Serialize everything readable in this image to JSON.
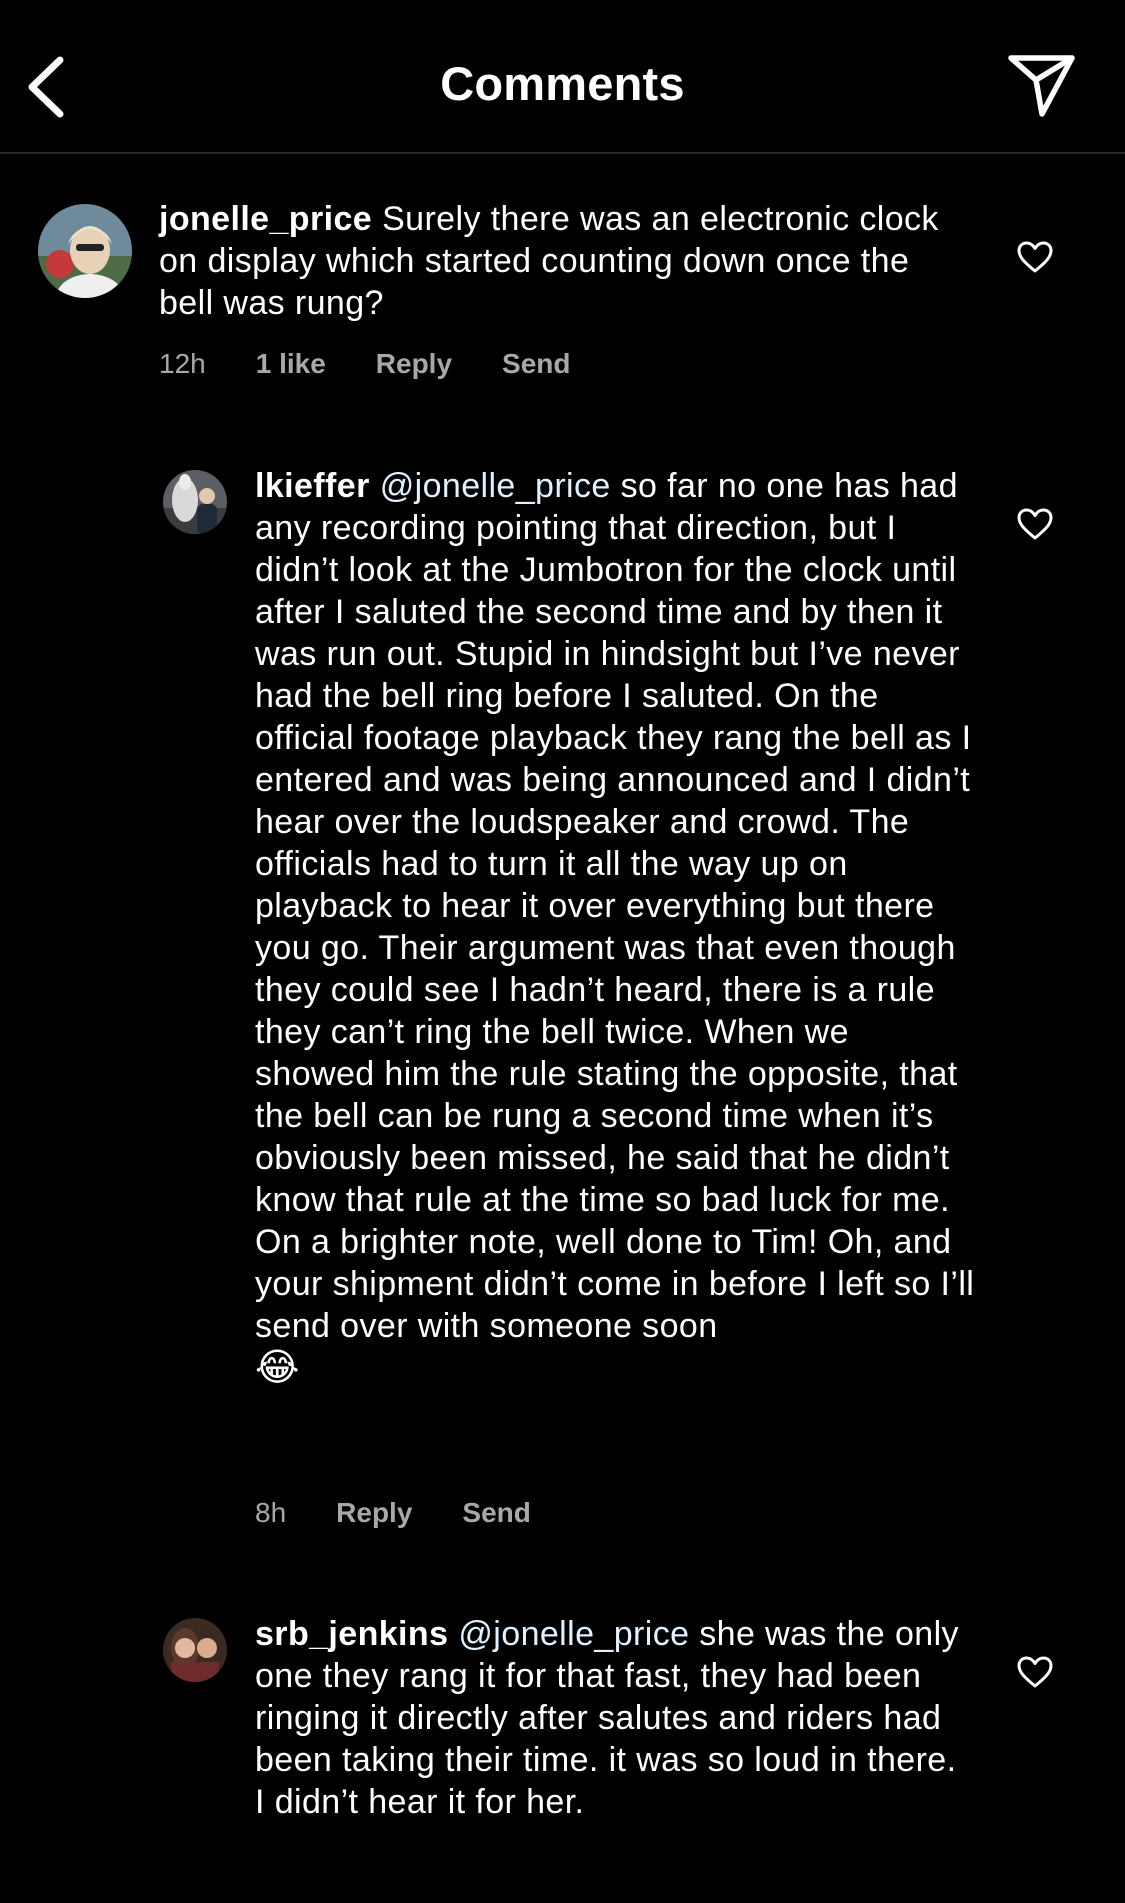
{
  "header": {
    "title": "Comments"
  },
  "comments": [
    {
      "username": "jonelle_price",
      "mention": "",
      "text": "Surely there was an electronic clock on display which started counting down once the bell was rung?",
      "emoji": "",
      "time": "12h",
      "likes": "1 like",
      "reply_label": "Reply",
      "send_label": "Send"
    },
    {
      "username": "lkieffer",
      "mention": "@jonelle_price",
      "text": "so far no one has had any recording pointing that direction, but I didn’t look at the Jumbotron for the clock until after I saluted the second time and by then it was run out. Stupid in hindsight but I’ve never had the bell ring before I saluted. On the official footage playback they rang the bell as I entered and was being announced and I didn’t hear over the loudspeaker and crowd. The officials had to turn it all the way up on playback to hear it over everything but there you go. Their argument was that even though they could see I hadn’t heard, there is a rule they can’t ring the bell twice. When we showed him the rule stating the opposite, that the bell can be rung a second time when it’s obviously been missed, he said that he didn’t know that rule at the time so bad luck for me. On a brighter note, well done to Tim! Oh, and your shipment didn’t come in before I left so I’ll send over with someone soon",
      "emoji": "😂",
      "time": "8h",
      "likes": "",
      "reply_label": "Reply",
      "send_label": "Send"
    },
    {
      "username": "srb_jenkins",
      "mention": "@jonelle_price",
      "text": "she was the only one they rang it for that fast, they had been ringing it directly after salutes and riders had been taking their time. it was so loud in there. I didn’t hear it for her.",
      "emoji": "",
      "time": "",
      "likes": "",
      "reply_label": "",
      "send_label": ""
    }
  ],
  "colors": {
    "background": "#000000",
    "text": "#ffffff",
    "meta": "#a8a8a8",
    "divider": "#262626"
  },
  "icons": {
    "back": "chevron-left-icon",
    "send": "paper-plane-icon",
    "like": "heart-outline-icon"
  }
}
